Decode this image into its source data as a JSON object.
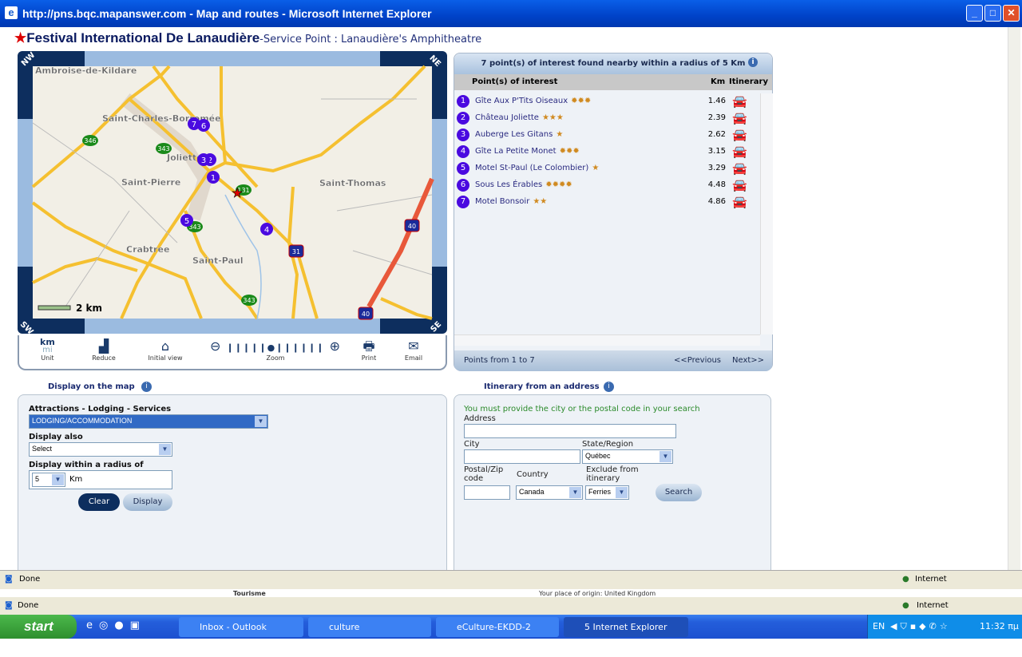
{
  "window": {
    "title": "http://pns.bqc.mapanswer.com - Map and routes - Microsoft Internet Explorer"
  },
  "header": {
    "title": "Festival International De Lanaudière",
    "separator": "-",
    "subtitle": "Service Point : Lanaudière's Amphitheatre"
  },
  "map": {
    "corners": {
      "nw": "NW",
      "ne": "NE",
      "sw": "SW",
      "se": "SE"
    },
    "scale": "2 km",
    "places": [
      "Saint-Charles-Borromée",
      "Joliette",
      "Saint-Pierre",
      "Saint-Thomas",
      "Crabtree",
      "Saint-Paul",
      "Ambroise-de-Kildare"
    ],
    "shields": [
      "346",
      "343",
      "131",
      "343",
      "343",
      "31",
      "40",
      "40"
    ],
    "markers": [
      "1",
      "2",
      "3",
      "4",
      "5",
      "6",
      "7"
    ],
    "road_color": "#f5c030",
    "highway_color": "#e8583a",
    "marker_color": "#4a0ae0"
  },
  "toolbar": {
    "unit_km": "km",
    "unit_mi": "mi",
    "unit": "Unit",
    "reduce": "Reduce",
    "initial_view": "Initial view",
    "zoom": "Zoom",
    "print": "Print",
    "email": "Email",
    "zoom_level": 5,
    "zoom_steps": 12
  },
  "poi": {
    "heading": "7 point(s) of interest found nearby within a radius of 5 Km",
    "columns": {
      "name": "Point(s) of interest",
      "km": "Km",
      "itinerary": "Itinerary"
    },
    "items": [
      {
        "num": "1",
        "name": "Gîte Aux P'Tits Oiseaux",
        "rating": "✹✹✹",
        "km": "1.46"
      },
      {
        "num": "2",
        "name": "Château Joliette",
        "rating": "★★★",
        "km": "2.39"
      },
      {
        "num": "3",
        "name": "Auberge Les Gitans",
        "rating": "★",
        "km": "2.62"
      },
      {
        "num": "4",
        "name": "Gîte La Petite Monet",
        "rating": "✹✹✹",
        "km": "3.15"
      },
      {
        "num": "5",
        "name": "Motel St-Paul (Le Colombier)",
        "rating": "★",
        "km": "3.29"
      },
      {
        "num": "6",
        "name": "Sous Les Érables",
        "rating": "✹✹✹✹",
        "km": "4.48"
      },
      {
        "num": "7",
        "name": "Motel Bonsoir",
        "rating": "★★",
        "km": "4.86"
      }
    ],
    "pagination": "Points from 1 to 7",
    "previous": "<<Previous",
    "next": "Next>>"
  },
  "display_panel": {
    "tab": "Display on the map",
    "category_label": "Attractions - Lodging - Services",
    "category_value": "LODGING/ACCOMMODATION",
    "also_label": "Display also",
    "also_value": "Select",
    "radius_label": "Display within a radius of",
    "radius_value": "5",
    "radius_unit": "Km",
    "clear": "Clear",
    "display": "Display"
  },
  "itinerary_panel": {
    "tab": "Itinerary from an address",
    "notice": "You must provide the city or the postal code in your search",
    "address_label": "Address",
    "address_value": "",
    "city_label": "City",
    "city_value": "",
    "region_label": "State/Region",
    "region_value": "Québec",
    "postal_label": "Postal/Zip code",
    "postal_value": "",
    "country_label": "Country",
    "country_value": "Canada",
    "exclude_label": "Exclude from itinerary",
    "exclude_value": "Ferries",
    "search": "Search"
  },
  "statusbar": {
    "text": "Done",
    "zone": "Internet"
  },
  "background_window": {
    "text1": "Tourisme",
    "text2": "Your place of origin: United Kingdom"
  },
  "taskbar": {
    "start": "start",
    "tasks": [
      "Inbox - Outlook Express",
      "culture",
      "eCulture-EKDD-2",
      "5 Internet Explorer"
    ],
    "lang": "EN",
    "clock": "11:32 πμ"
  }
}
